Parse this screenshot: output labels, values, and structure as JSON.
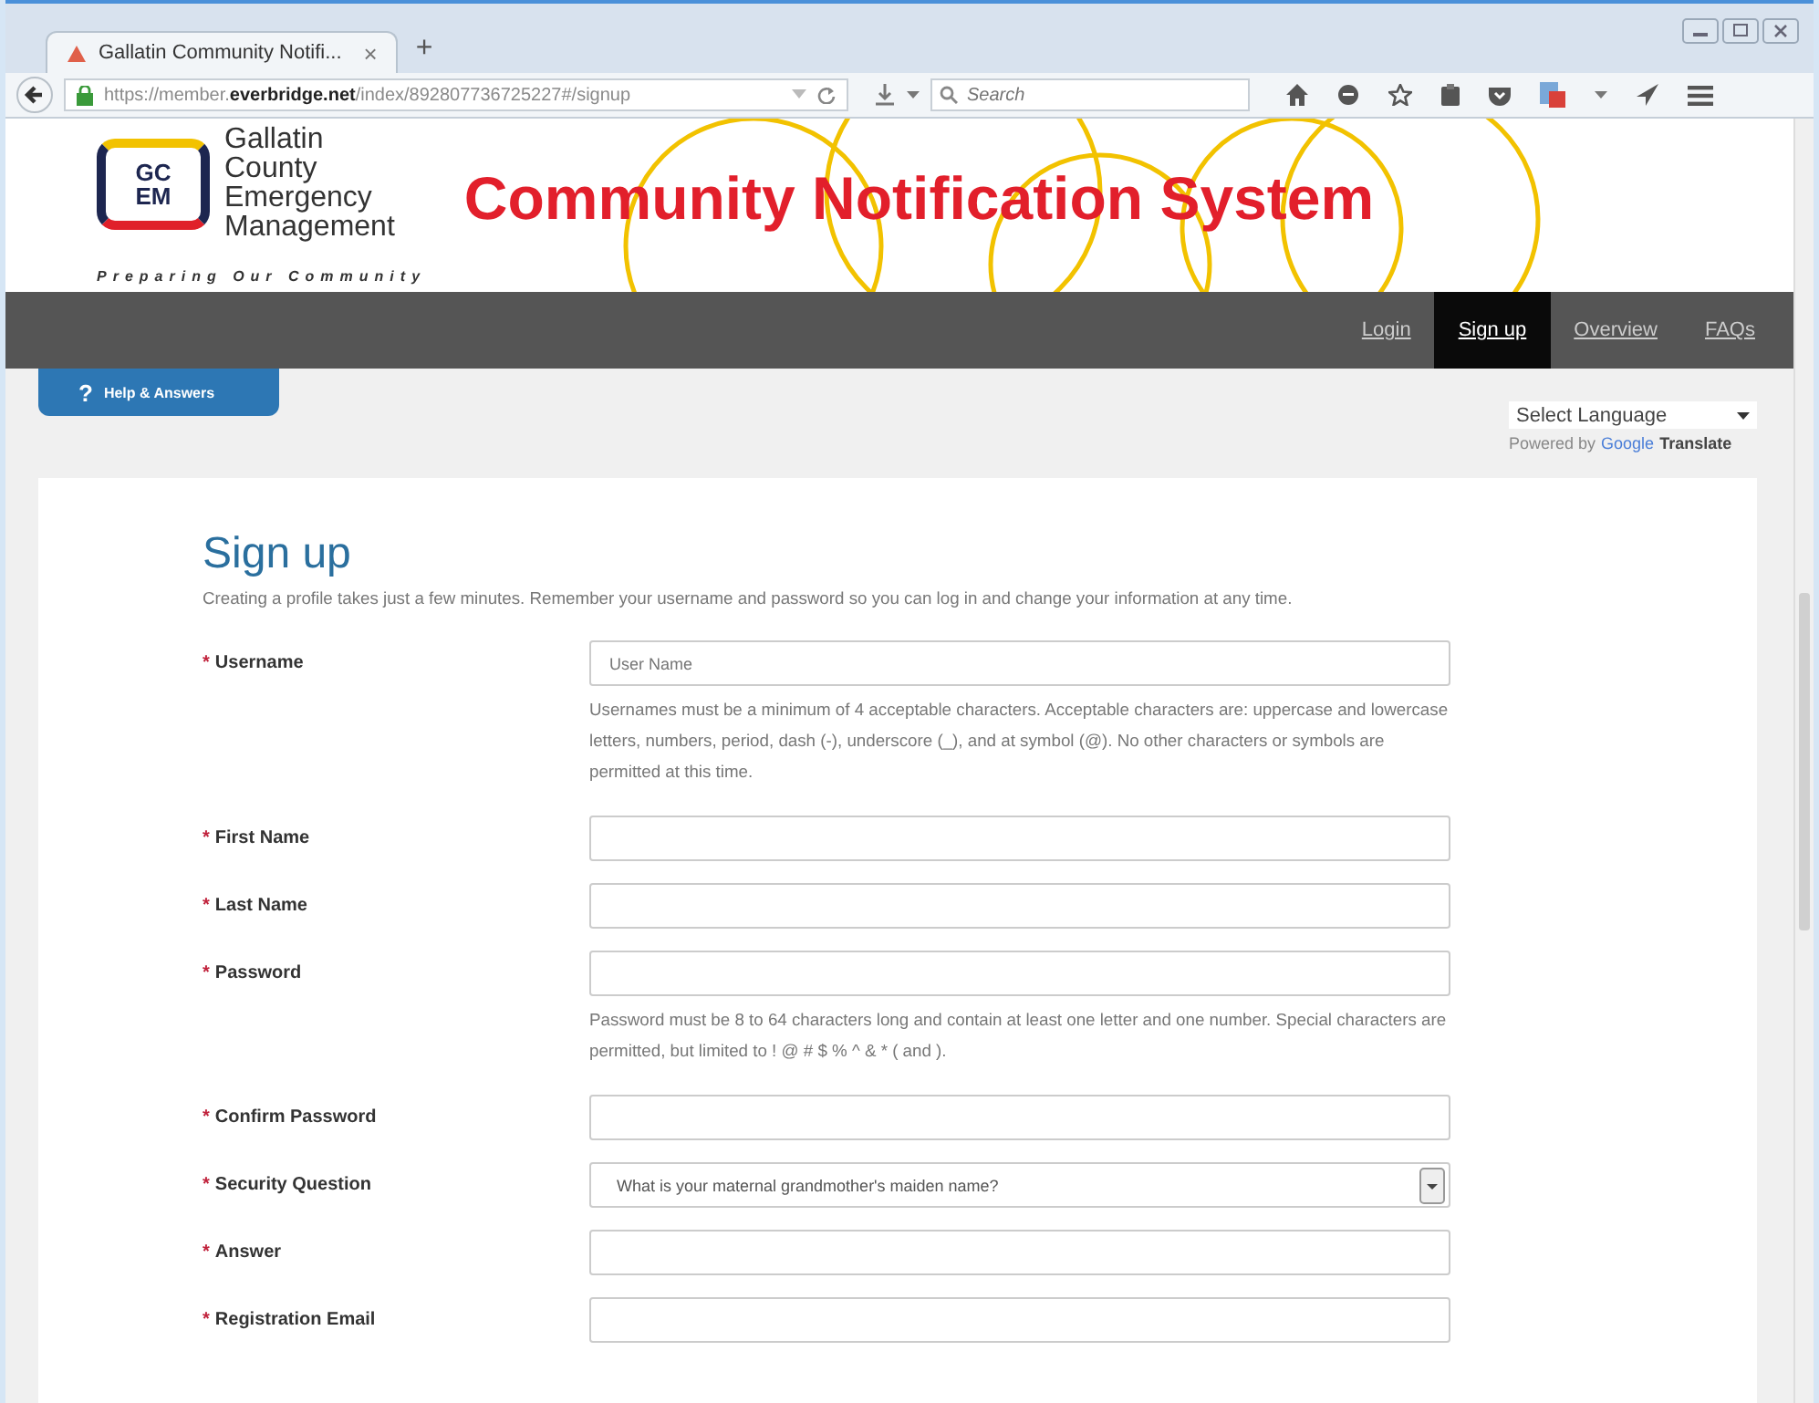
{
  "browser": {
    "tab": {
      "title": "Gallatin Community Notifi...",
      "close": "×"
    },
    "new_tab": "+",
    "url": "https://member.**everbridge.net**/index/892807736725227#/signup",
    "search": {
      "placeholder": "Search"
    }
  },
  "header": {
    "logo": {
      "top": "GC",
      "bottom": "EM"
    },
    "org_lines": [
      "Gallatin",
      "County",
      "Emergency",
      "Management"
    ],
    "tagline": "Preparing Our Community",
    "title": "Community Notification System"
  },
  "nav": [
    {
      "label": "Login",
      "selected": false
    },
    {
      "label": "Sign up",
      "selected": true
    },
    {
      "label": "Overview",
      "selected": false
    },
    {
      "label": "FAQs",
      "selected": false
    }
  ],
  "help": {
    "icon": "?",
    "label": "Help & Answers"
  },
  "language": {
    "value": "Select Language",
    "powered_by": "Powered by",
    "google": "Google",
    "translate": "Translate"
  },
  "form": {
    "title": "Sign up",
    "intro": "Creating a profile takes just a few minutes. Remember your username and password so you can log in and change your information at any time.",
    "fields": [
      {
        "kind": "text",
        "marker": "*",
        "label": "Username",
        "placeholder": "User Name",
        "hint": "Usernames must be a minimum of 4 acceptable characters. Acceptable characters are: uppercase and lowercase letters, numbers, period, dash (-), underscore (_), and at symbol (@). No other characters or symbols are permitted at this time."
      },
      {
        "kind": "text",
        "marker": "*",
        "label": "First Name"
      },
      {
        "kind": "text",
        "marker": "*",
        "label": "Last Name"
      },
      {
        "kind": "text",
        "marker": "*",
        "label": "Password",
        "hint": "Password must be 8 to 64 characters long and contain at least one letter and one number. Special characters are permitted, but limited to ! @ # $ % ^ & * ( and )."
      },
      {
        "kind": "text",
        "marker": "*",
        "label": "Confirm Password"
      },
      {
        "kind": "select",
        "marker": "*",
        "label": "Security Question",
        "value": "What is your maternal grandmother's maiden name?"
      },
      {
        "kind": "text",
        "marker": "*",
        "label": "Answer"
      },
      {
        "kind": "text",
        "marker": "*",
        "label": "Registration Email"
      }
    ]
  }
}
